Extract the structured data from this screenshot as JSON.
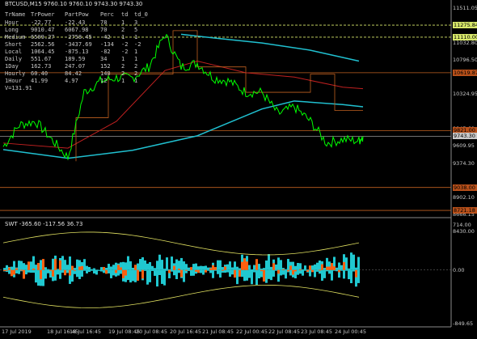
{
  "header": {
    "text": "BTCUSD,M15  9760.10 9760.10 9743.30 9743.30"
  },
  "table": {
    "columns": [
      "TrName",
      "TrPower",
      "PartPow",
      "Perc",
      "td",
      "td_0"
    ],
    "rows": [
      [
        "Hour",
        "-22.77",
        "-22.43",
        "78",
        "1",
        "3"
      ],
      [
        "Long",
        "9010.47",
        "6067.98",
        "70",
        "2",
        "5"
      ],
      [
        "Medium",
        "6509.27",
        "-2758.45",
        "-42",
        "1",
        "1"
      ],
      [
        "Short",
        "2562.56",
        "-3437.69",
        "-134",
        "-2",
        "-2"
      ],
      [
        "Local",
        "1064.45",
        "-875.13",
        "-82",
        "-2",
        "1"
      ],
      [
        "Daily",
        "551.67",
        "189.59",
        "34",
        "1",
        "1"
      ],
      [
        "1Day",
        "162.73",
        "247.07",
        "152",
        "2",
        "2"
      ],
      [
        "Hourly",
        "60.40",
        "84.42",
        "140",
        "2",
        "2"
      ],
      [
        "1Hour",
        "41.99",
        "4.97",
        "12",
        "1",
        "1"
      ]
    ],
    "footer": "V=131.91"
  },
  "price_labels": [
    "11511.05",
    "11032.80",
    "10796.50",
    "10324.95",
    "9845.60",
    "9609.95",
    "9374.30",
    "8902.10",
    "8666.15",
    "8430.00"
  ],
  "price_tags": [
    {
      "text": "11275.84",
      "color": "#d8e86a",
      "text_color": "#000000"
    },
    {
      "text": "11110.00",
      "color": "#d8e86a",
      "text_color": "#000000"
    },
    {
      "text": "10619.87",
      "color": "#b8501a",
      "text_color": "#000000"
    },
    {
      "text": "9821.00",
      "color": "#b8501a",
      "text_color": "#000000"
    },
    {
      "text": "9743.30",
      "color": "#c8c8c8",
      "text_color": "#000000"
    },
    {
      "text": "9038.00",
      "color": "#b8501a",
      "text_color": "#000000"
    },
    {
      "text": "8721.18",
      "color": "#b8501a",
      "text_color": "#000000"
    }
  ],
  "subwindow": {
    "header": "SWT -365.60 -117.56 36.73",
    "labels": [
      "714.00",
      "0.00",
      "-849.65"
    ]
  },
  "x_labels": [
    "17 Jul 2019",
    "18 Jul 16:45",
    "18 Jul 16:45",
    "19 Jul 08:45",
    "20 Jul 08:45",
    "20 Jul 16:45",
    "21 Jul 08:45",
    "22 Jul 00:45",
    "22 Jul 08:45",
    "23 Jul 08:45",
    "24 Jul 00:45"
  ],
  "chart_data": [
    {
      "type": "line",
      "title": "BTCUSD,M15",
      "series": [
        {
          "name": "BTCUSD",
          "x": [
            0,
            20,
            40,
            60,
            80,
            100,
            120,
            140,
            160,
            180,
            200,
            220,
            240,
            260,
            280,
            300,
            320,
            340,
            360,
            380,
            400,
            420,
            440,
            445
          ],
          "values": [
            9600,
            9900,
            9950,
            9700,
            9450,
            10350,
            10500,
            10550,
            10550,
            10700,
            11150,
            10700,
            10750,
            10550,
            10500,
            10350,
            10350,
            10050,
            10150,
            9950,
            9650,
            9700,
            9680,
            9743
          ]
        }
      ],
      "ylim": [
        8666.15,
        11511.05
      ],
      "colors": {
        "price": "#00ff00",
        "ma_cyan": "#20c0d0",
        "ma_red": "#c02020",
        "level_orange": "#c06020",
        "level_yellow": "#d8e86a"
      }
    },
    {
      "type": "area",
      "title": "SWT",
      "ylim": [
        -849.65,
        714.0
      ]
    }
  ]
}
